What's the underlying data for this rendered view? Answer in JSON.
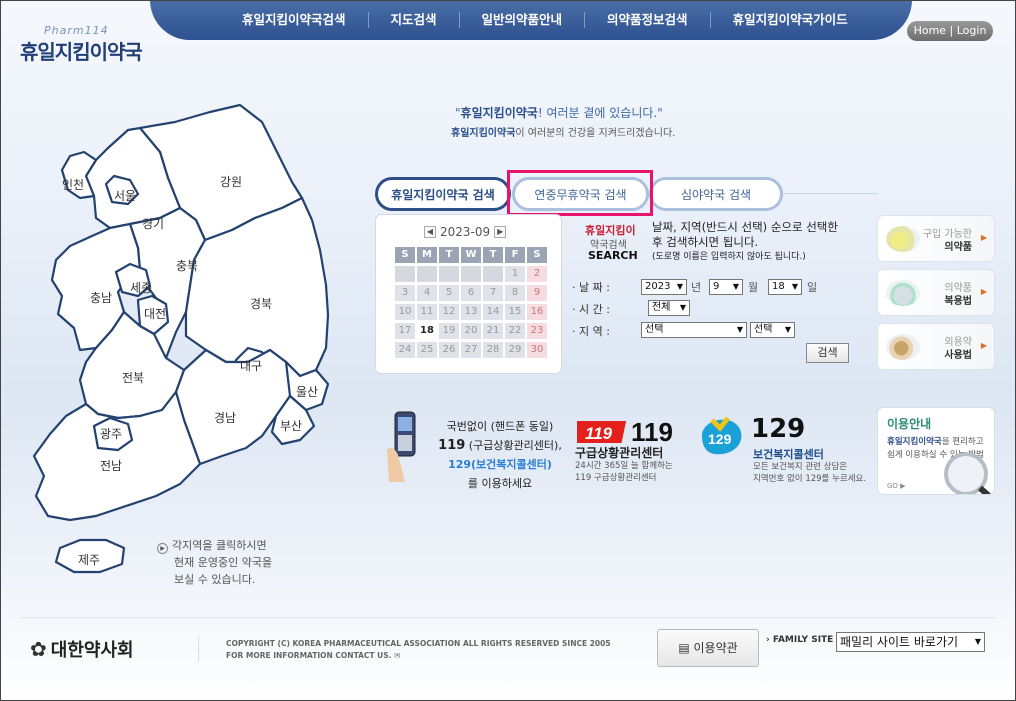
{
  "logo": {
    "en": "Pharm114",
    "ko": "휴일지킴이약국"
  },
  "nav": [
    "휴일지킴이약국검색",
    "지도검색",
    "일반의약품안내",
    "의약품정보검색",
    "휴일지킴이약국가이드"
  ],
  "home_login": "Home | Login",
  "slogan": {
    "quote_open": "\"",
    "brand": "휴일지킴이약국",
    "line1_rest": "! 여러분 곁에 있습니다.\"",
    "line2_brand": "휴일지킴이약국",
    "line2_rest": "이 여러분의 건강을 지켜드리겠습니다."
  },
  "tabs": [
    "휴일지킴이약국 검색",
    "연중무휴약국 검색",
    "심야약국 검색"
  ],
  "calendar": {
    "title": "2023-09",
    "prev": "◀",
    "next": "▶",
    "weekdays": [
      "S",
      "M",
      "T",
      "W",
      "T",
      "F",
      "S"
    ],
    "days": [
      "",
      "",
      "",
      "",
      "",
      "1",
      "2",
      "3",
      "4",
      "5",
      "6",
      "7",
      "8",
      "9",
      "10",
      "11",
      "12",
      "13",
      "14",
      "15",
      "16",
      "17",
      "18",
      "19",
      "20",
      "21",
      "22",
      "23",
      "24",
      "25",
      "26",
      "27",
      "28",
      "29",
      "30"
    ],
    "today": "18"
  },
  "form": {
    "logo_line1": "휴일지킴이",
    "logo_line2": "약국검색",
    "logo_line3": "SEARCH",
    "desc": "날짜, 지역(반드시 선택) 순으로 선택한 후 검색하시면 됩니다.",
    "note": "(도로명 이름은 입력하지 않아도 됩니다.)",
    "date_label": "· 날 짜 :",
    "time_label": "· 시 간 :",
    "region_label": "· 지 역 :",
    "year": "2023",
    "year_unit": "년",
    "month": "9",
    "month_unit": "월",
    "day": "18",
    "day_unit": "일",
    "time": "전체",
    "region1": "선택",
    "region2": "선택",
    "search_button": "검색"
  },
  "guides": [
    {
      "line1": "구입 가능한",
      "line2": "의약품",
      "icon": "pill-icon"
    },
    {
      "line1": "의약품",
      "line2": "복용법",
      "icon": "mortar-icon"
    },
    {
      "line1": "외용약",
      "line2": "사용법",
      "icon": "ointment-icon"
    }
  ],
  "info": {
    "line1": "국번없이 (핸드폰 동일)",
    "line2_num": "119",
    "line2_rest": " (구급상황관리센터),",
    "line3": "129(보건복지콜센터)",
    "line4": "를 이용하세요",
    "e119_logo": "119",
    "e119_big": "119",
    "e119_title": "구급상황관리센터",
    "e119_desc1": "24시간 365일 늘 함께하는",
    "e119_desc2": "119 구급상황관리센터",
    "c129_logo": "129",
    "c129_big": "129",
    "c129_title": "보건복지콜센터",
    "c129_desc1": "모든 보건복지 관련 상담은",
    "c129_desc2": "지역번호 없이 129를 누르세요."
  },
  "use_guide": {
    "title": "이용안내",
    "brand": "휴일지킴이약국",
    "desc_rest": "을 편리하고 쉽게 이용하실 수 있는 방법",
    "go": "GO ▶"
  },
  "map": {
    "regions": [
      "인천",
      "서울",
      "경기",
      "강원",
      "충북",
      "충남",
      "세종",
      "대전",
      "경북",
      "대구",
      "전북",
      "울산",
      "경남",
      "부산",
      "광주",
      "전남",
      "제주"
    ],
    "hint_line1": "각지역을 클릭하시면",
    "hint_line2": "현재 운영중인 약국을",
    "hint_line3": "보실 수 있습니다."
  },
  "footer": {
    "org": "대한약사회",
    "copyright1": "COPYRIGHT (C) KOREA PHARMACEUTICAL ASSOCIATION ALL RIGHTS RESERVED SINCE 2005",
    "copyright2": "FOR MORE INFORMATION CONTACT US.",
    "terms_button": "이용약관",
    "family_label": "› FAMILY SITE",
    "family_select": "패밀리 사이트 바로가기"
  },
  "colors": {
    "nav_bg": "#2e5190",
    "brand_navy": "#24426f",
    "highlight": "#e8136c",
    "saturday": "#c77777"
  }
}
